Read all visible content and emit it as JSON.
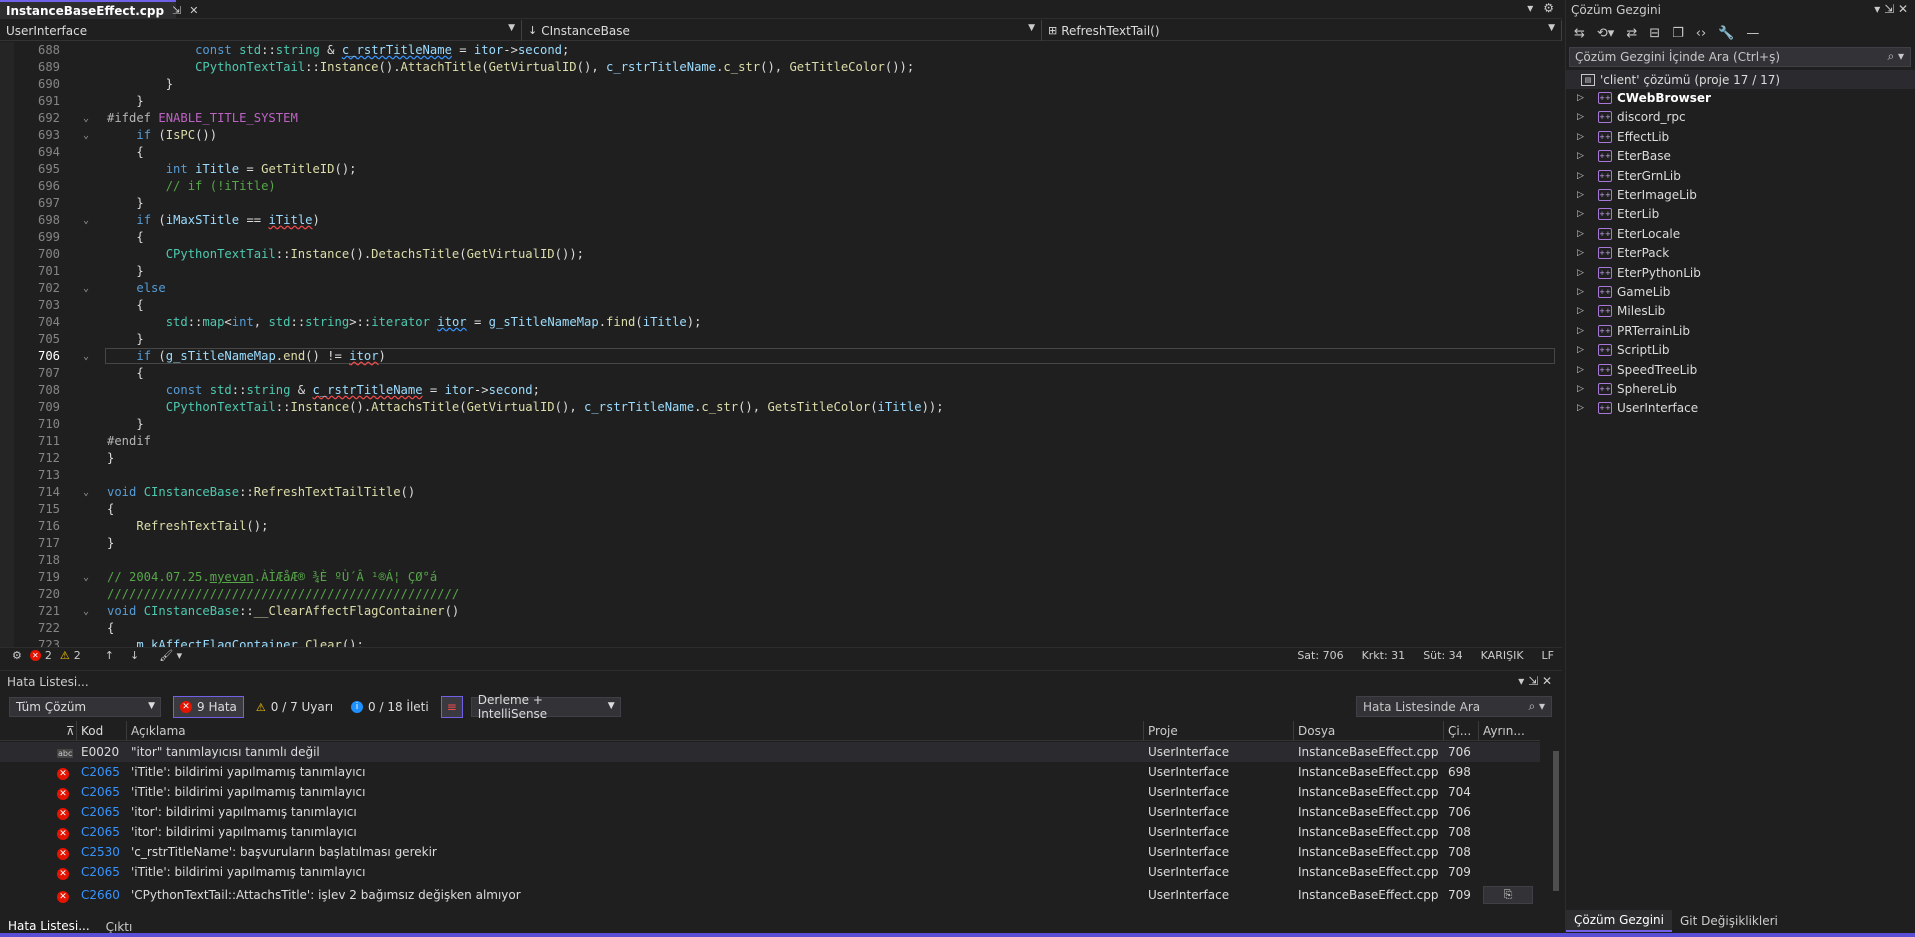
{
  "document_tab": {
    "title": "InstanceBaseEffect.cpp",
    "pin": "⇲",
    "close": "✕"
  },
  "tab_strip_right": {
    "overflow": "▾",
    "settings": "⚙"
  },
  "nav_bar": {
    "project": "UserInterface",
    "class_icon": "↓",
    "class_name": "CInstanceBase",
    "member_icon": "⊞",
    "member": "RefreshTextTail()"
  },
  "code_lines": [
    {
      "num": "688",
      "fold": "",
      "html": "            <span class=\"k\">const</span> <span class=\"t\">std</span>::<span class=\"t\">string</span> &amp; <span class=\"v sq-green\">c_rstrTitleName</span> = <span class=\"v\">itor</span>-&gt;<span class=\"v\">second</span>;"
    },
    {
      "num": "689",
      "fold": "",
      "html": "            <span class=\"t\">CPythonTextTail</span>::<span class=\"f\">Instance</span>().<span class=\"f\">AttachTitle</span>(<span class=\"f\">GetVirtualID</span>(), <span class=\"v\">c_rstrTitleName</span>.<span class=\"f\">c_str</span>(), <span class=\"f\">GetTitleColor</span>());"
    },
    {
      "num": "690",
      "fold": "",
      "html": "        }"
    },
    {
      "num": "691",
      "fold": "",
      "html": "    }"
    },
    {
      "num": "692",
      "fold": "⌄",
      "html": "<span class=\"p\">#ifdef</span> <span class=\"m\">ENABLE_TITLE_SYSTEM</span>"
    },
    {
      "num": "693",
      "fold": "⌄",
      "html": "    <span class=\"k\">if</span> (<span class=\"f\">IsPC</span>())"
    },
    {
      "num": "694",
      "fold": "",
      "html": "    {"
    },
    {
      "num": "695",
      "fold": "",
      "html": "        <span class=\"k\">int</span> <span class=\"v\">iTitle</span> = <span class=\"f\">GetTitleID</span>();"
    },
    {
      "num": "696",
      "fold": "",
      "html": "        <span class=\"c\">// if (!iTitle)</span>"
    },
    {
      "num": "697",
      "fold": "",
      "html": "    }"
    },
    {
      "num": "698",
      "fold": "⌄",
      "html": "    <span class=\"k\">if</span> (<span class=\"v\">iMaxSTitle</span> == <span class=\"v sq-red\">iTitle</span>)"
    },
    {
      "num": "699",
      "fold": "",
      "html": "    {"
    },
    {
      "num": "700",
      "fold": "",
      "html": "        <span class=\"t\">CPythonTextTail</span>::<span class=\"f\">Instance</span>().<span class=\"f\">DetachsTitle</span>(<span class=\"f\">GetVirtualID</span>());"
    },
    {
      "num": "701",
      "fold": "",
      "html": "    }"
    },
    {
      "num": "702",
      "fold": "⌄",
      "html": "    <span class=\"k\">else</span>"
    },
    {
      "num": "703",
      "fold": "",
      "html": "    {"
    },
    {
      "num": "704",
      "fold": "",
      "html": "        <span class=\"t\">std</span>::<span class=\"t\">map</span>&lt;<span class=\"k\">int</span>, <span class=\"t\">std</span>::<span class=\"t\">string</span>&gt;::<span class=\"t\">iterator</span> <span class=\"v sq-green\">itor</span> = <span class=\"v\">g_sTitleNameMap</span>.<span class=\"f\">find</span>(<span class=\"v\">iTitle</span>);"
    },
    {
      "num": "705",
      "fold": "",
      "html": "    }"
    },
    {
      "num": "706",
      "fold": "⌄",
      "html": "    <span class=\"k\">if</span> (<span class=\"v\">g_sTitleNameMap</span>.<span class=\"f\">end</span>() != <span class=\"v sq-red\">itor</span>)",
      "active": true
    },
    {
      "num": "707",
      "fold": "",
      "html": "    {"
    },
    {
      "num": "708",
      "fold": "",
      "html": "        <span class=\"k\">const</span> <span class=\"t\">std</span>::<span class=\"t\">string</span> &amp; <span class=\"v sq-red\">c_rstrTitleName</span> = <span class=\"v\">itor</span>-&gt;<span class=\"v\">second</span>;"
    },
    {
      "num": "709",
      "fold": "",
      "html": "        <span class=\"t\">CPythonTextTail</span>::<span class=\"f\">Instance</span>().<span class=\"f\">AttachsTitle</span>(<span class=\"f\">GetVirtualID</span>(), <span class=\"v\">c_rstrTitleName</span>.<span class=\"f\">c_str</span>(), <span class=\"f\">GetsTitleColor</span>(<span class=\"v\">iTitle</span>));"
    },
    {
      "num": "710",
      "fold": "",
      "html": "    }"
    },
    {
      "num": "711",
      "fold": "",
      "html": "<span class=\"p\">#endif</span>"
    },
    {
      "num": "712",
      "fold": "",
      "html": "}"
    },
    {
      "num": "713",
      "fold": "",
      "html": ""
    },
    {
      "num": "714",
      "fold": "⌄",
      "html": "<span class=\"k\">void</span> <span class=\"t\">CInstanceBase</span>::<span class=\"f\">RefreshTextTailTitle</span>()"
    },
    {
      "num": "715",
      "fold": "",
      "html": "{"
    },
    {
      "num": "716",
      "fold": "",
      "html": "    <span class=\"f\">RefreshTextTail</span>();"
    },
    {
      "num": "717",
      "fold": "",
      "html": "}"
    },
    {
      "num": "718",
      "fold": "",
      "html": ""
    },
    {
      "num": "719",
      "fold": "⌄",
      "html": "<span class=\"c\">// 2004.07.25.<u>myevan</u>.ÀÌÆåÆ® ¾È ºÙ´Â ¹®Á¦ ÇØ°á</span>"
    },
    {
      "num": "720",
      "fold": "",
      "html": "<span class=\"c\">////////////////////////////////////////////////</span>"
    },
    {
      "num": "721",
      "fold": "⌄",
      "html": "<span class=\"k\">void</span> <span class=\"t\">CInstanceBase</span>::<span class=\"f\">__ClearAffectFlagContainer</span>()"
    },
    {
      "num": "722",
      "fold": "",
      "html": "{"
    },
    {
      "num": "723",
      "fold": "",
      "html": "    <span class=\"v\">m_kAffectFlagContainer</span>.<span class=\"f\">Clear</span>();"
    }
  ],
  "editor_status": {
    "errors": "2",
    "warnings": "2",
    "up": "↑",
    "down": "↓",
    "brush": "🖌 ▾",
    "line": "Sat: 706",
    "char": "Krkt: 31",
    "col": "Süt: 34",
    "tabs": "KARIŞIK",
    "eol": "LF"
  },
  "error_panel": {
    "title": "Hata Listesi...",
    "header_buttons": "▾ ⇲ ✕",
    "scope": "Tüm Çözüm",
    "errors_label": "9 Hata",
    "warnings_label": "0 / 7 Uyarı",
    "messages_label": "0 / 18 İleti",
    "source": "Derleme + IntelliSense",
    "search_placeholder": "Hata Listesinde Ara",
    "columns": {
      "code": "Kod",
      "description": "Açıklama",
      "project": "Proje",
      "file": "Dosya",
      "line": "Çi...",
      "suppression": "Ayrın..."
    },
    "rows": [
      {
        "type": "abc",
        "code": "E0020",
        "description": "\"itor\" tanımlayıcısı tanımlı değil",
        "project": "UserInterface",
        "file": "InstanceBaseEffect.cpp",
        "line": "706"
      },
      {
        "type": "err",
        "code": "C2065",
        "description": "'iTitle': bildirimi yapılmamış tanımlayıcı",
        "project": "UserInterface",
        "file": "InstanceBaseEffect.cpp",
        "line": "698"
      },
      {
        "type": "err",
        "code": "C2065",
        "description": "'iTitle': bildirimi yapılmamış tanımlayıcı",
        "project": "UserInterface",
        "file": "InstanceBaseEffect.cpp",
        "line": "704"
      },
      {
        "type": "err",
        "code": "C2065",
        "description": "'itor': bildirimi yapılmamış tanımlayıcı",
        "project": "UserInterface",
        "file": "InstanceBaseEffect.cpp",
        "line": "706"
      },
      {
        "type": "err",
        "code": "C2065",
        "description": "'itor': bildirimi yapılmamış tanımlayıcı",
        "project": "UserInterface",
        "file": "InstanceBaseEffect.cpp",
        "line": "708"
      },
      {
        "type": "err",
        "code": "C2530",
        "description": "'c_rstrTitleName': başvuruların başlatılması gerekir",
        "project": "UserInterface",
        "file": "InstanceBaseEffect.cpp",
        "line": "708"
      },
      {
        "type": "err",
        "code": "C2065",
        "description": "'iTitle': bildirimi yapılmamış tanımlayıcı",
        "project": "UserInterface",
        "file": "InstanceBaseEffect.cpp",
        "line": "709"
      },
      {
        "type": "err",
        "code": "C2660",
        "description": "'CPythonTextTail::AttachsTitle': işlev 2 bağımsız değişken almıyor",
        "project": "UserInterface",
        "file": "InstanceBaseEffect.cpp",
        "line": "709",
        "has_button": true
      }
    ],
    "bottom_tabs": [
      "Hata Listesi...",
      "Çıktı"
    ]
  },
  "solution_explorer": {
    "title": "Çözüm Gezgini",
    "title_buttons": "▾ ⇲ ✕",
    "search_placeholder": "Çözüm Gezgini İçinde Ara (Ctrl+ş)",
    "root": "'client' çözümü (proje 17 / 17)",
    "projects": [
      "CWebBrowser",
      "discord_rpc",
      "EffectLib",
      "EterBase",
      "EterGrnLib",
      "EterImageLib",
      "EterLib",
      "EterLocale",
      "EterPack",
      "EterPythonLib",
      "GameLib",
      "MilesLib",
      "PRTerrainLib",
      "ScriptLib",
      "SpeedTreeLib",
      "SphereLib",
      "UserInterface"
    ],
    "bold_project": "CWebBrowser",
    "bottom_tabs": [
      "Çözüm Gezgini",
      "Git Değişiklikleri"
    ]
  },
  "colors": {
    "accent": "#7160e8",
    "error": "#e51400",
    "warning": "#ffcc00",
    "link": "#3794ff"
  }
}
